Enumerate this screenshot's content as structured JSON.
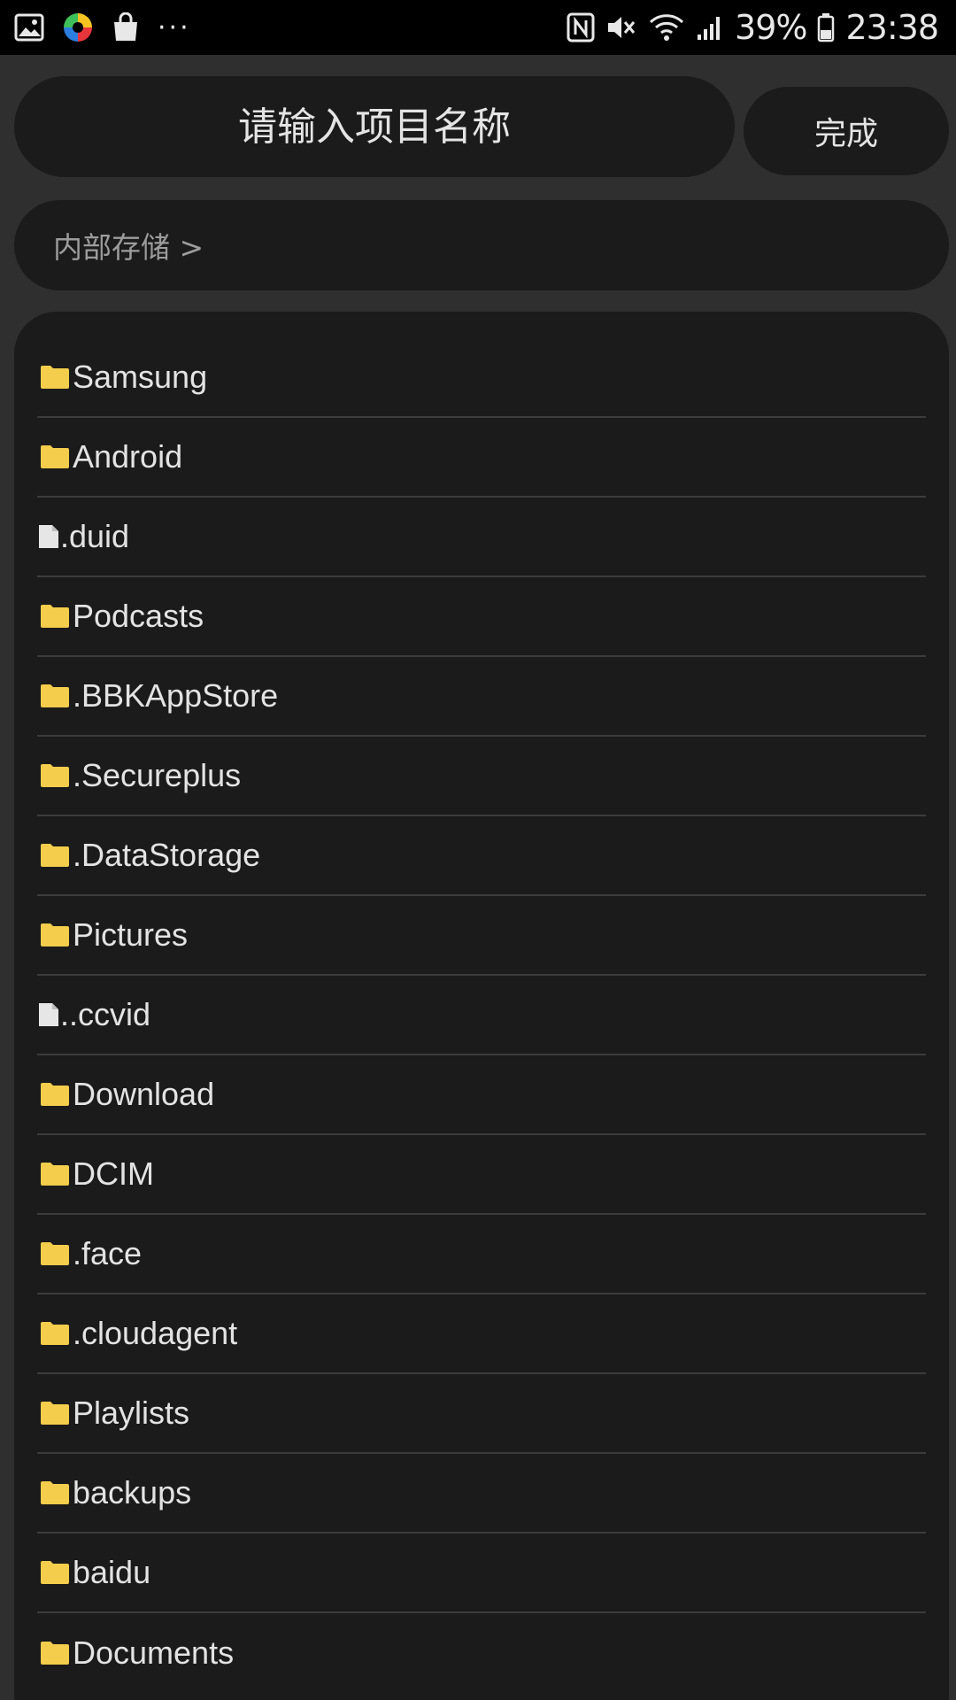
{
  "status_bar": {
    "battery": "39%",
    "time": "23:38",
    "more": "···",
    "left_icons": [
      "gallery-icon",
      "color-wheel-icon",
      "shopping-bag-icon"
    ],
    "right_icons": [
      "nfc-icon",
      "mute-icon",
      "wifi-icon",
      "signal-icon",
      "battery-icon"
    ]
  },
  "header": {
    "name_placeholder": "请输入项目名称",
    "done_label": "完成"
  },
  "breadcrumb": {
    "path": "内部存储 >"
  },
  "colors": {
    "background": "#2f2f2f",
    "panel": "#1b1b1b",
    "folder": "#f3cd4b",
    "file": "#e6e6e6",
    "divider": "#3c3c3c"
  },
  "files": [
    {
      "name": "Samsung",
      "type": "folder"
    },
    {
      "name": "Android",
      "type": "folder"
    },
    {
      "name": ".duid",
      "type": "file"
    },
    {
      "name": "Podcasts",
      "type": "folder"
    },
    {
      "name": ".BBKAppStore",
      "type": "folder"
    },
    {
      "name": ".Secureplus",
      "type": "folder"
    },
    {
      "name": ".DataStorage",
      "type": "folder"
    },
    {
      "name": "Pictures",
      "type": "folder"
    },
    {
      "name": "..ccvid",
      "type": "file"
    },
    {
      "name": "Download",
      "type": "folder"
    },
    {
      "name": "DCIM",
      "type": "folder"
    },
    {
      "name": ".face",
      "type": "folder"
    },
    {
      "name": ".cloudagent",
      "type": "folder"
    },
    {
      "name": "Playlists",
      "type": "folder"
    },
    {
      "name": "backups",
      "type": "folder"
    },
    {
      "name": "baidu",
      "type": "folder"
    },
    {
      "name": "Documents",
      "type": "folder"
    }
  ]
}
